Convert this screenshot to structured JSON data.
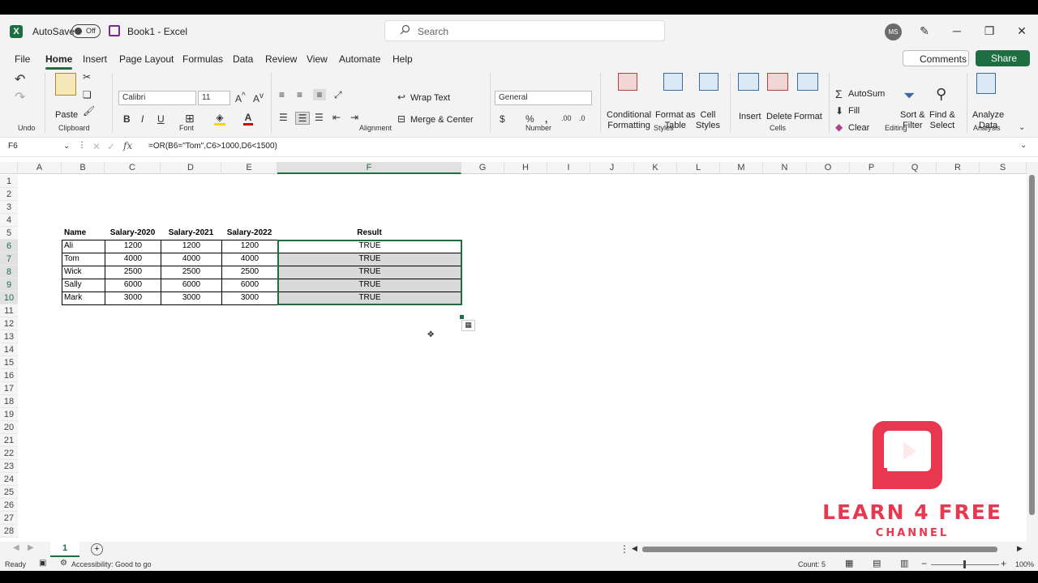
{
  "titlebar": {
    "autosave_label": "AutoSave",
    "autosave_state": "Off",
    "doc_title": "Book1  -  Excel",
    "search_placeholder": "Search",
    "user_initials": "MS"
  },
  "menu": {
    "tabs": [
      "File",
      "Home",
      "Insert",
      "Page Layout",
      "Formulas",
      "Data",
      "Review",
      "View",
      "Automate",
      "Help"
    ],
    "active_tab": "Home",
    "comments": "Comments",
    "share": "Share"
  },
  "ribbon": {
    "undo_group": "Undo",
    "clipboard": {
      "paste": "Paste",
      "label": "Clipboard"
    },
    "font": {
      "name": "Calibri",
      "size": "11",
      "label": "Font",
      "bold": "B",
      "italic": "I",
      "underline": "U"
    },
    "alignment": {
      "wrap": "Wrap Text",
      "merge": "Merge & Center",
      "label": "Alignment"
    },
    "number": {
      "format": "General",
      "label": "Number"
    },
    "styles": {
      "conditional": "Conditional",
      "conditional2": "Formatting",
      "format_table": "Format as",
      "format_table2": "Table",
      "cell_styles": "Cell",
      "cell_styles2": "Styles",
      "label": "Styles"
    },
    "cells": {
      "insert": "Insert",
      "delete": "Delete",
      "format": "Format",
      "label": "Cells"
    },
    "editing": {
      "autosum": "AutoSum",
      "fill": "Fill",
      "clear": "Clear",
      "sort": "Sort &",
      "sort2": "Filter",
      "find": "Find &",
      "find2": "Select",
      "label": "Editing"
    },
    "analysis": {
      "analyze": "Analyze",
      "analyze2": "Data",
      "label": "Analysis"
    }
  },
  "formula_bar": {
    "name_box": "F6",
    "formula": "=OR(B6=\"Tom\",C6>1000,D6<1500)"
  },
  "sheet": {
    "columns": [
      "A",
      "B",
      "C",
      "D",
      "E",
      "F",
      "G",
      "H",
      "I",
      "J",
      "K",
      "L",
      "M",
      "N",
      "O",
      "P",
      "Q",
      "R",
      "S"
    ],
    "selected_column": "F",
    "rows": [
      "1",
      "2",
      "3",
      "4",
      "5",
      "6",
      "7",
      "8",
      "9",
      "10",
      "11",
      "12",
      "13",
      "14",
      "15",
      "16",
      "17",
      "18",
      "19",
      "20",
      "21",
      "22",
      "23",
      "24",
      "25",
      "26",
      "27",
      "28"
    ],
    "headers": [
      "Name",
      "Salary-2020",
      "Salary-2021",
      "Salary-2022",
      "Result"
    ],
    "data": [
      [
        "Ali",
        "1200",
        "1200",
        "1200",
        "TRUE"
      ],
      [
        "Tom",
        "4000",
        "4000",
        "4000",
        "TRUE"
      ],
      [
        "Wick",
        "2500",
        "2500",
        "2500",
        "TRUE"
      ],
      [
        "Sally",
        "6000",
        "6000",
        "6000",
        "TRUE"
      ],
      [
        "Mark",
        "3000",
        "3000",
        "3000",
        "TRUE"
      ]
    ]
  },
  "sheet_tab": "1",
  "status": {
    "ready": "Ready",
    "accessibility": "Accessibility: Good to go",
    "count": "Count: 5",
    "zoom": "100%"
  },
  "watermark": {
    "line1": "LEARN 4 FREE",
    "line2": "CHANNEL",
    "brand_color": "#e8384f"
  }
}
